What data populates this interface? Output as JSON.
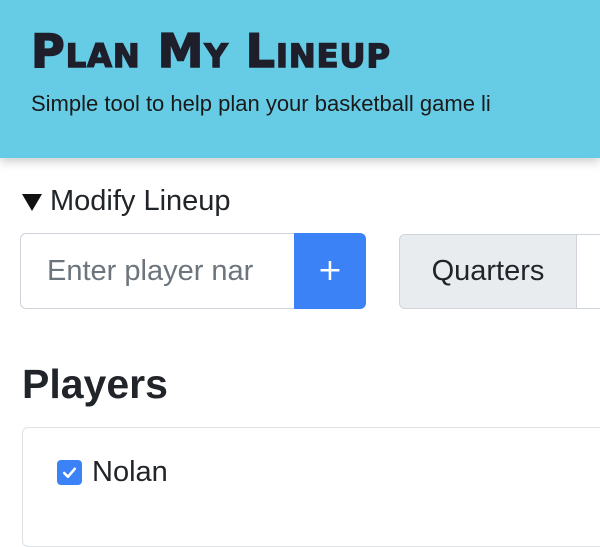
{
  "header": {
    "title": "Plan My Lineup",
    "subtitle": "Simple tool to help plan your basketball game li"
  },
  "modify_lineup": {
    "summary_label": "Modify Lineup",
    "player_input": {
      "value": "",
      "placeholder": "Enter player nar"
    },
    "add_button_label": "+",
    "quarters_label": "Quarters"
  },
  "players": {
    "heading": "Players",
    "items": [
      {
        "name": "Nolan",
        "checked": true
      }
    ]
  },
  "colors": {
    "header_bg": "#66cce5",
    "accent": "#3b82f6"
  }
}
